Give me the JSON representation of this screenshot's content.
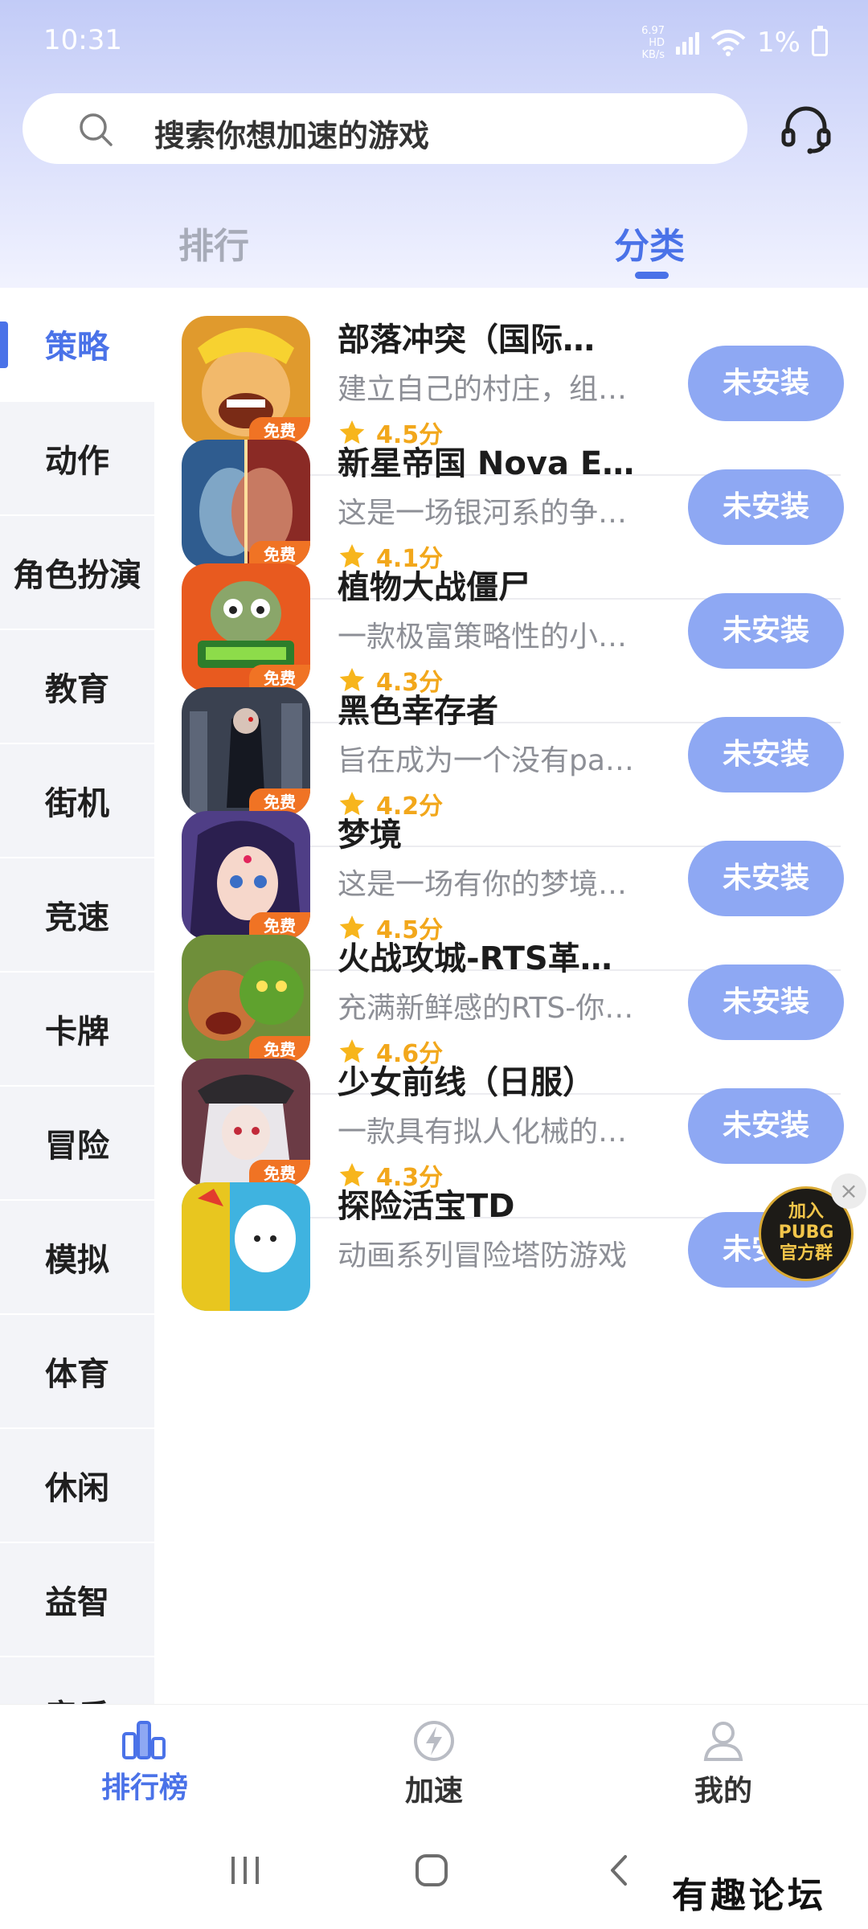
{
  "status_bar": {
    "time": "10:31",
    "net_speed_value": "6.97",
    "net_speed_unit": "KB/s",
    "net_type": "HD",
    "battery": "1%"
  },
  "search": {
    "placeholder": "搜索你想加速的游戏"
  },
  "tabs": [
    {
      "label": "排行",
      "active": false
    },
    {
      "label": "分类",
      "active": true
    }
  ],
  "categories": [
    {
      "label": "策略",
      "active": true
    },
    {
      "label": "动作"
    },
    {
      "label": "角色扮演"
    },
    {
      "label": "教育"
    },
    {
      "label": "街机"
    },
    {
      "label": "竞速"
    },
    {
      "label": "卡牌"
    },
    {
      "label": "冒险"
    },
    {
      "label": "模拟"
    },
    {
      "label": "体育"
    },
    {
      "label": "休闲"
    },
    {
      "label": "益智"
    },
    {
      "label": "音乐"
    }
  ],
  "games": [
    {
      "name": "部落冲突（国际…",
      "desc": "建立自己的村庄，组…",
      "rating": "4.5分",
      "free": "免费",
      "button": "未安装"
    },
    {
      "name": "新星帝国 Nova E…",
      "desc": "这是一场银河系的争…",
      "rating": "4.1分",
      "free": "免费",
      "button": "未安装"
    },
    {
      "name": "植物大战僵尸",
      "desc": "一款极富策略性的小…",
      "rating": "4.3分",
      "free": "免费",
      "button": "未安装"
    },
    {
      "name": "黑色幸存者",
      "desc": "旨在成为一个没有pa…",
      "rating": "4.2分",
      "free": "免费",
      "button": "未安装"
    },
    {
      "name": "梦境",
      "desc": "这是一场有你的梦境…",
      "rating": "4.5分",
      "free": "免费",
      "button": "未安装"
    },
    {
      "name": "火战攻城-RTS革…",
      "desc": "充满新鲜感的RTS-你…",
      "rating": "4.6分",
      "free": "免费",
      "button": "未安装"
    },
    {
      "name": "少女前线（日服）",
      "desc": "一款具有拟人化械的…",
      "rating": "4.3分",
      "free": "免费",
      "button": "未安装"
    },
    {
      "name": "探险活宝TD",
      "desc": "动画系列冒险塔防游戏",
      "rating": "",
      "free": "",
      "button": "未安装"
    }
  ],
  "float_badge": {
    "line1": "加入",
    "line2": "PUBG",
    "line3": "官方群",
    "close": "×"
  },
  "bottom_nav": [
    {
      "label": "排行榜",
      "active": true,
      "icon": "bar-chart-icon"
    },
    {
      "label": "加速",
      "active": false,
      "icon": "lightning-icon"
    },
    {
      "label": "我的",
      "active": false,
      "icon": "user-icon"
    }
  ],
  "watermark": "有趣论坛",
  "colors": {
    "accent": "#4a72e8",
    "install_button": "#8ea8f3",
    "rating": "#f2a71b",
    "free_tag": "#f07324"
  }
}
